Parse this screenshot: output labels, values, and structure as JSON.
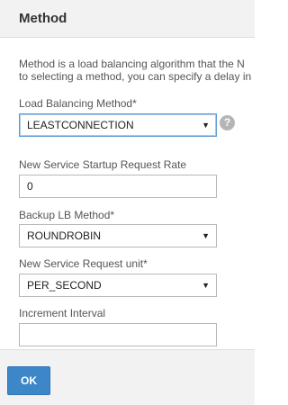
{
  "panel": {
    "title": "Method",
    "description_line1": "Method is a load balancing algorithm that the N",
    "description_line2": "to selecting a method, you can specify a delay in"
  },
  "fields": {
    "lb_method": {
      "label": "Load Balancing Method*",
      "value": "LEASTCONNECTION"
    },
    "startup_rate": {
      "label": "New Service Startup Request Rate",
      "value": "0"
    },
    "backup_method": {
      "label": "Backup LB Method*",
      "value": "ROUNDROBIN"
    },
    "request_unit": {
      "label": "New Service Request unit*",
      "value": "PER_SECOND"
    },
    "increment_interval": {
      "label": "Increment Interval",
      "value": ""
    }
  },
  "help_icon": {
    "glyph": "?"
  },
  "caret_glyph": "▼",
  "footer": {
    "ok_label": "OK"
  },
  "colors": {
    "accent": "#3d87c8",
    "focus_border": "#5a9bd5"
  }
}
